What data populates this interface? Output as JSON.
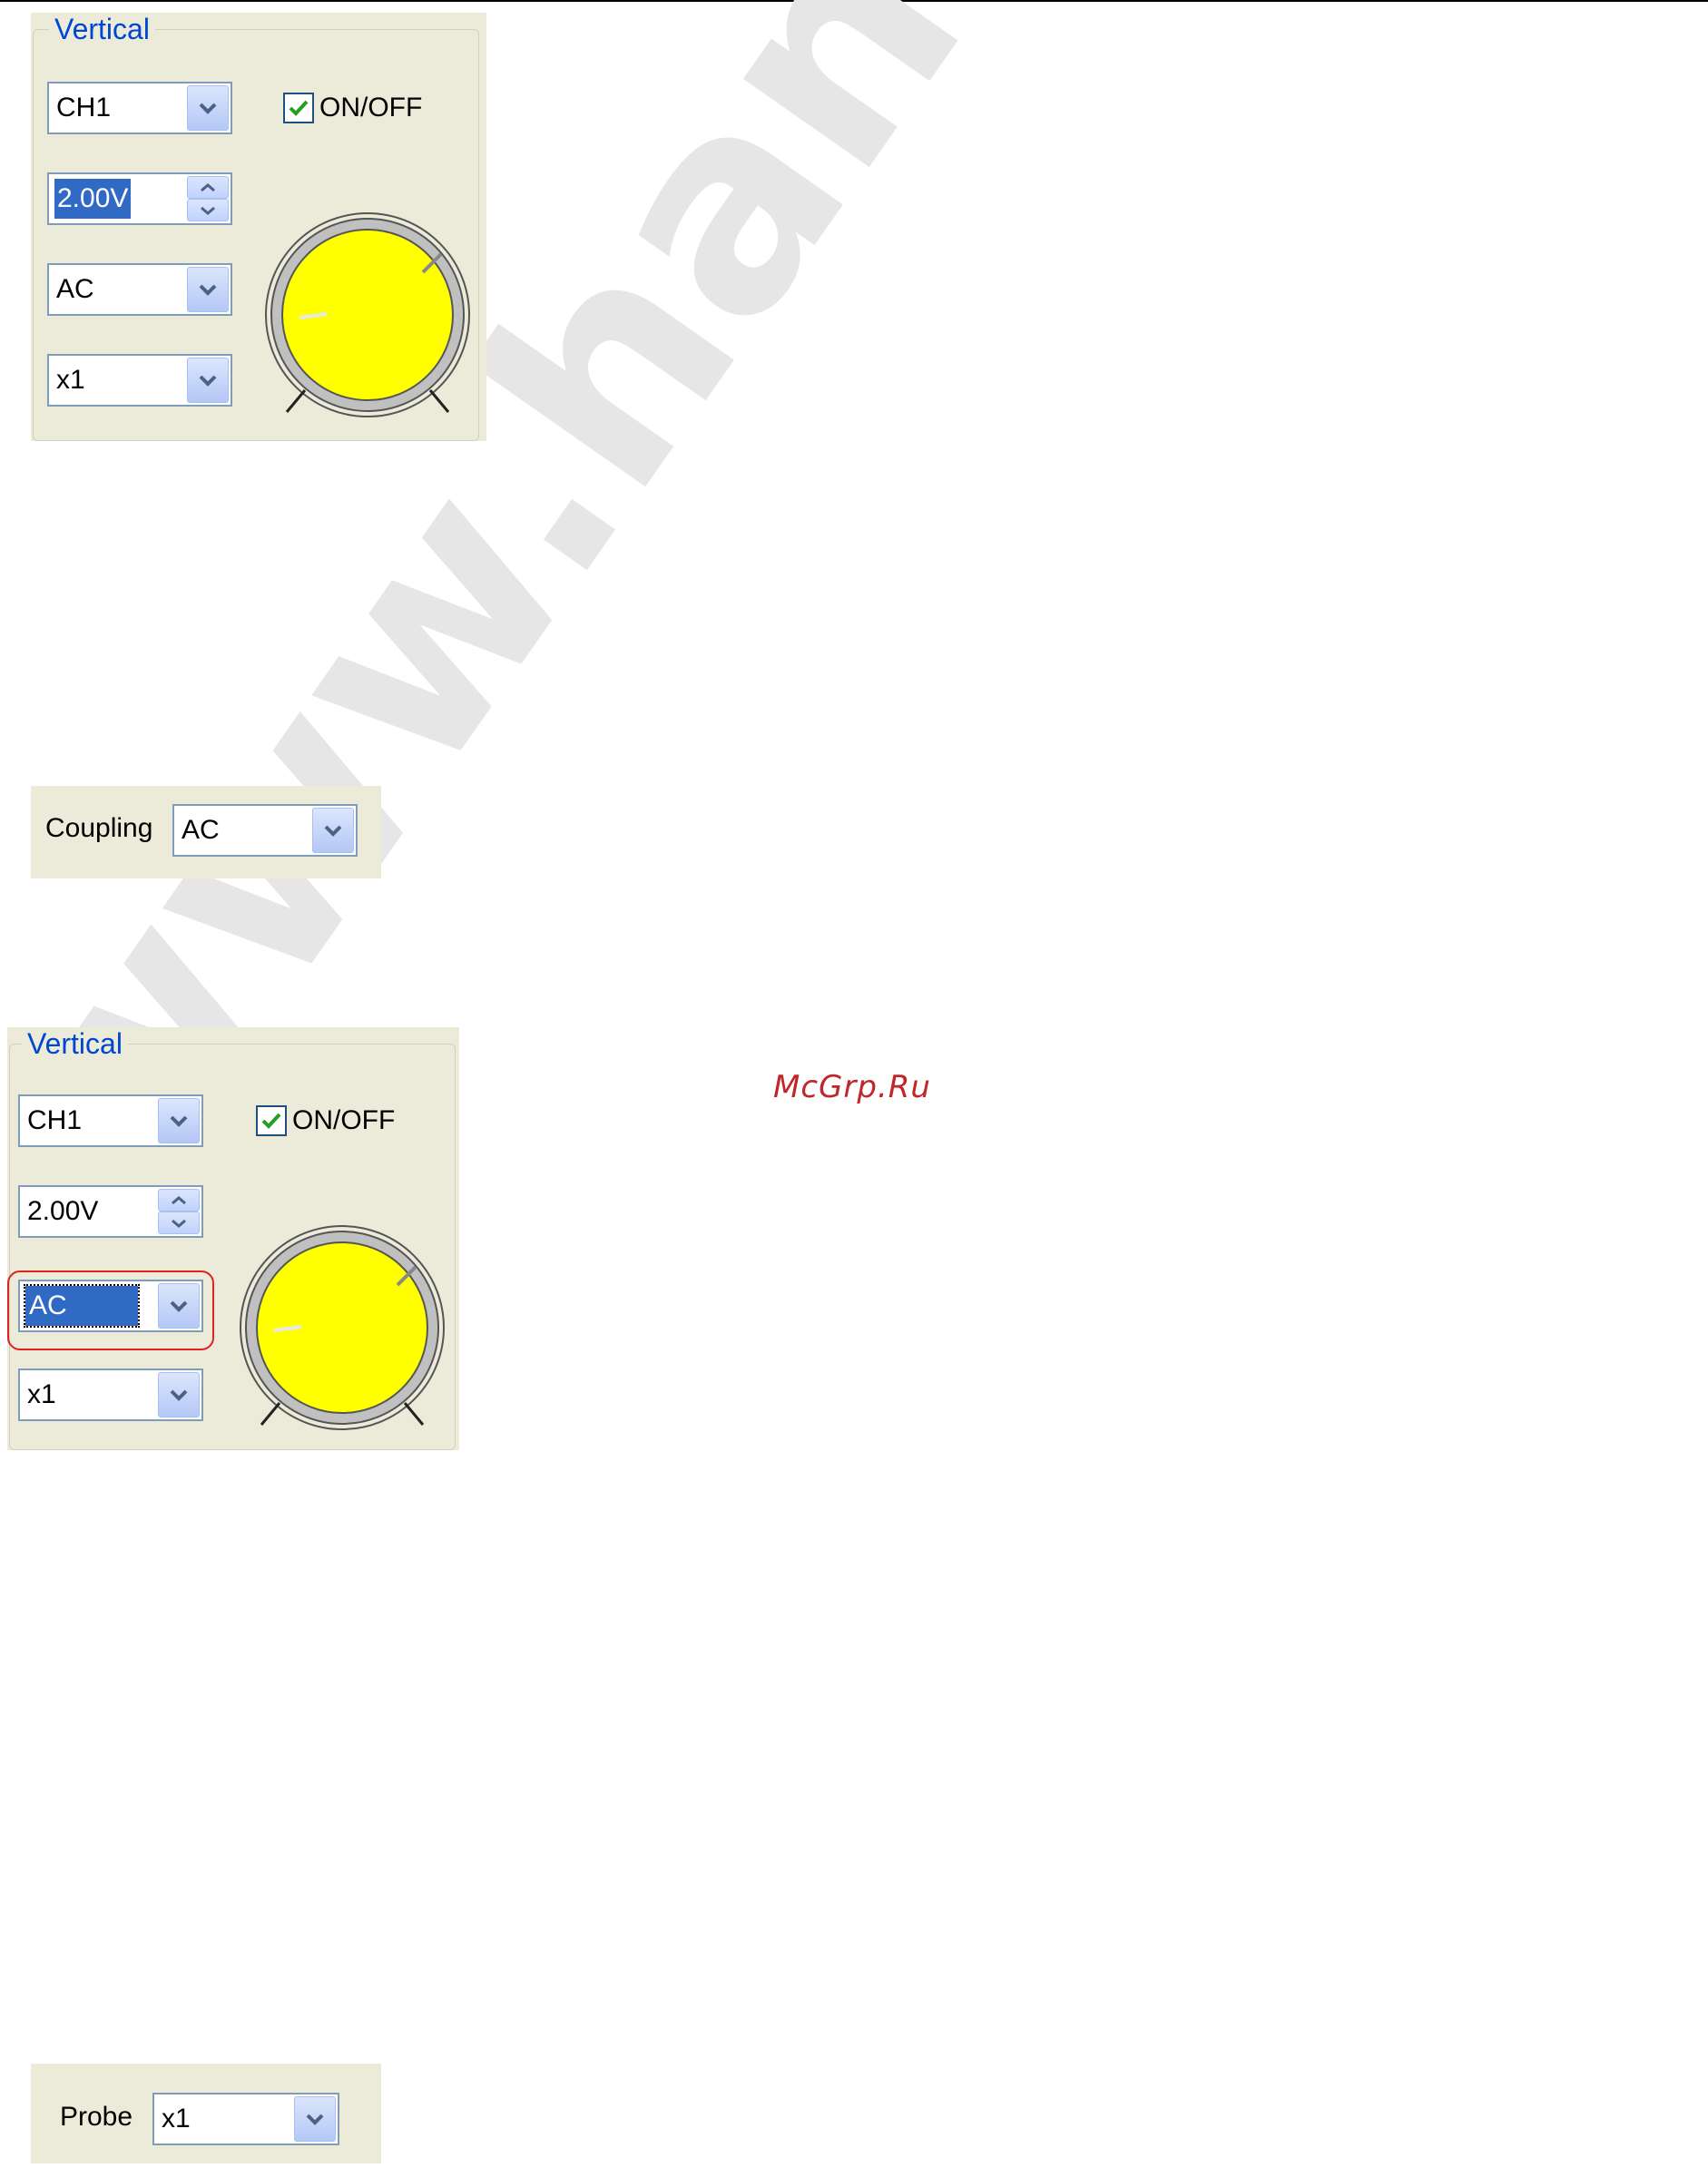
{
  "watermark": {
    "site": "www.hantek.ru",
    "caption": "McGrp.Ru"
  },
  "panel1": {
    "legend": "Vertical",
    "channel": "CH1",
    "onoff_label": "ON/OFF",
    "onoff_checked": true,
    "volts": "2.00V",
    "coupling": "AC",
    "probe": "x1"
  },
  "coupling_panel": {
    "label": "Coupling",
    "value": "AC"
  },
  "panel2": {
    "legend": "Vertical",
    "channel": "CH1",
    "onoff_label": "ON/OFF",
    "onoff_checked": true,
    "volts": "2.00V",
    "coupling": "AC",
    "probe": "x1"
  },
  "probe_panel": {
    "label": "Probe",
    "value": "x1"
  },
  "colors": {
    "panel_bg": "#ecead8",
    "legend_text": "#0046d5",
    "knob_fill": "#ffff00",
    "highlight_ring": "#e32020",
    "selection": "#316ac5"
  }
}
